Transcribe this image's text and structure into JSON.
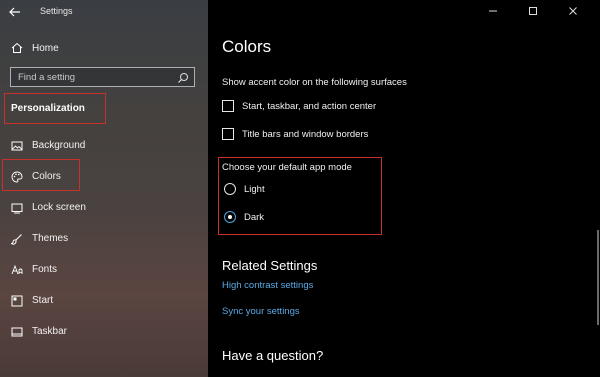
{
  "window": {
    "app_title": "Settings",
    "controls": [
      "minimize-icon",
      "maximize-icon",
      "close-icon"
    ]
  },
  "sidebar": {
    "back_icon": "arrow-left-icon",
    "home": {
      "label": "Home",
      "icon": "home-icon"
    },
    "search": {
      "placeholder": "Find a setting",
      "icon": "search-icon"
    },
    "section_title": "Personalization",
    "items": [
      {
        "label": "Background",
        "icon": "image-icon"
      },
      {
        "label": "Colors",
        "icon": "palette-icon",
        "selected": true
      },
      {
        "label": "Lock screen",
        "icon": "lock-screen-icon"
      },
      {
        "label": "Themes",
        "icon": "brush-icon"
      },
      {
        "label": "Fonts",
        "icon": "font-icon"
      },
      {
        "label": "Start",
        "icon": "start-icon"
      },
      {
        "label": "Taskbar",
        "icon": "taskbar-icon"
      }
    ],
    "highlight_color": "#c8302c"
  },
  "main": {
    "title": "Colors",
    "accent_surfaces_heading": "Show accent color on the following surfaces",
    "checkboxes": [
      {
        "label": "Start, taskbar, and action center",
        "checked": false
      },
      {
        "label": "Title bars and window borders",
        "checked": false
      }
    ],
    "app_mode": {
      "heading": "Choose your default app mode",
      "options": [
        {
          "label": "Light",
          "selected": false
        },
        {
          "label": "Dark",
          "selected": true
        }
      ]
    },
    "related": {
      "heading": "Related Settings",
      "links": [
        "High contrast settings",
        "Sync your settings"
      ]
    },
    "question_heading": "Have a question?",
    "link_color": "#5aa9e6",
    "accent_color": "#4da3d9"
  }
}
